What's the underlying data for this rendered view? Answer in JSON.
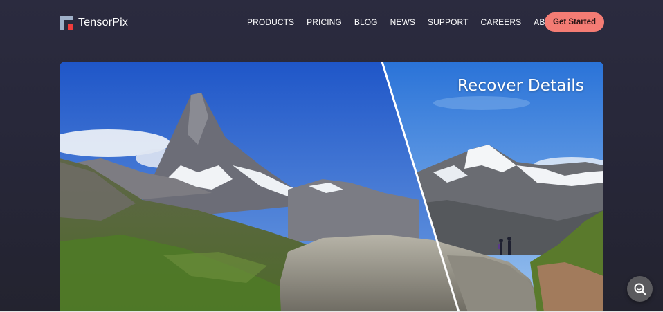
{
  "brand": {
    "name": "TensorPix",
    "logo_icon": "tensorpix-logo-icon"
  },
  "nav": {
    "items": [
      {
        "label": "PRODUCTS"
      },
      {
        "label": "PRICING"
      },
      {
        "label": "BLOG"
      },
      {
        "label": "NEWS"
      },
      {
        "label": "SUPPORT"
      },
      {
        "label": "CAREERS"
      },
      {
        "label": "ABOUT"
      }
    ],
    "cta_label": "Get Started"
  },
  "hero": {
    "caption": "Recover Details",
    "image": "matterhorn-before-after-comparison"
  },
  "chat_widget": {
    "icon": "search-chat-icon"
  },
  "colors": {
    "background": "#282839",
    "accent": "#f47c74",
    "logo_red": "#f03c3c"
  }
}
